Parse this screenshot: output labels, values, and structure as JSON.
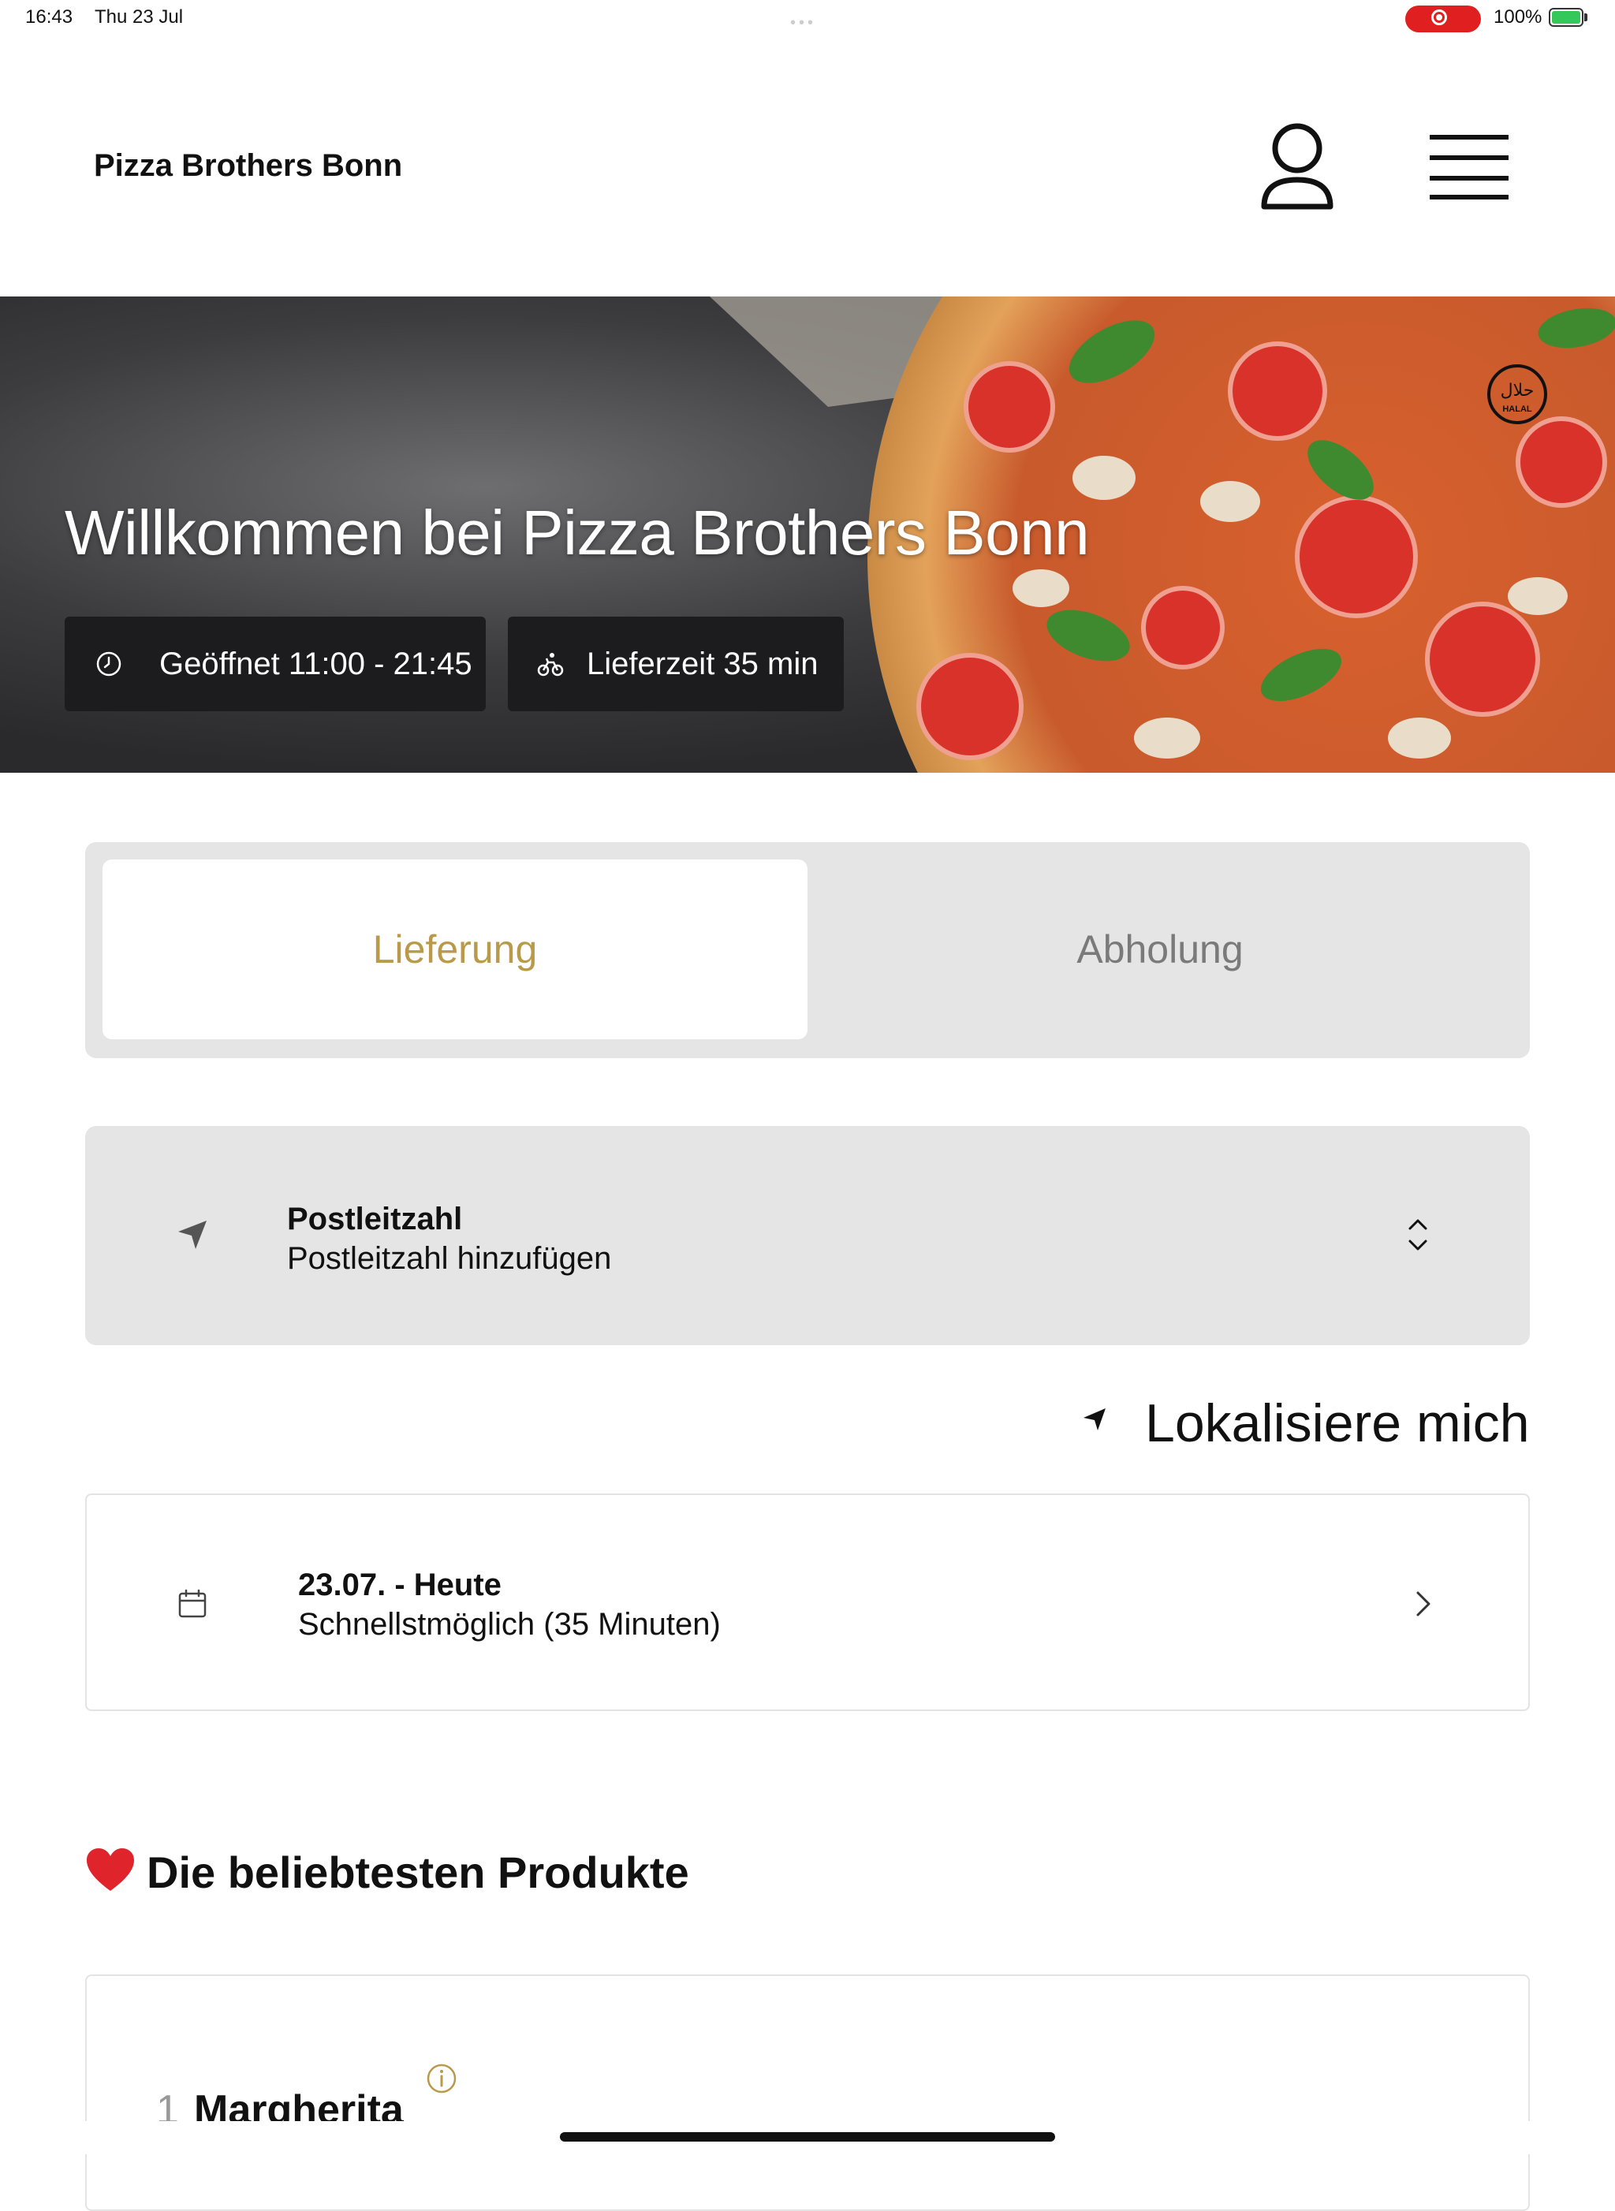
{
  "status_bar": {
    "time": "16:43",
    "date": "Thu 23 Jul",
    "battery": "100%",
    "recording_color": "#e02020"
  },
  "header": {
    "brand": "Pizza Brothers Bonn",
    "account_icon": "person-icon",
    "menu_icon": "hamburger-menu-icon"
  },
  "hero": {
    "title": "Willkommen bei Pizza Brothers Bonn",
    "badge_icon": "halal-icon",
    "pills": {
      "open": "Geöffnet 11:00 - 21:45",
      "delivery": "Lieferzeit 35 min"
    }
  },
  "order_mode": {
    "active": "Lieferung",
    "inactive": "Abholung",
    "accent": "#b89a4a"
  },
  "postcode": {
    "label": "Postleitzahl",
    "value": "Postleitzahl hinzufügen"
  },
  "locate": {
    "label": "Lokalisiere mich"
  },
  "schedule": {
    "title": "23.07. - Heute",
    "subtitle": "Schnellstmöglich (35 Minuten)"
  },
  "popular": {
    "title": "Die beliebtesten Produkte",
    "items": [
      {
        "number": "1",
        "name": "Margherita"
      }
    ]
  }
}
